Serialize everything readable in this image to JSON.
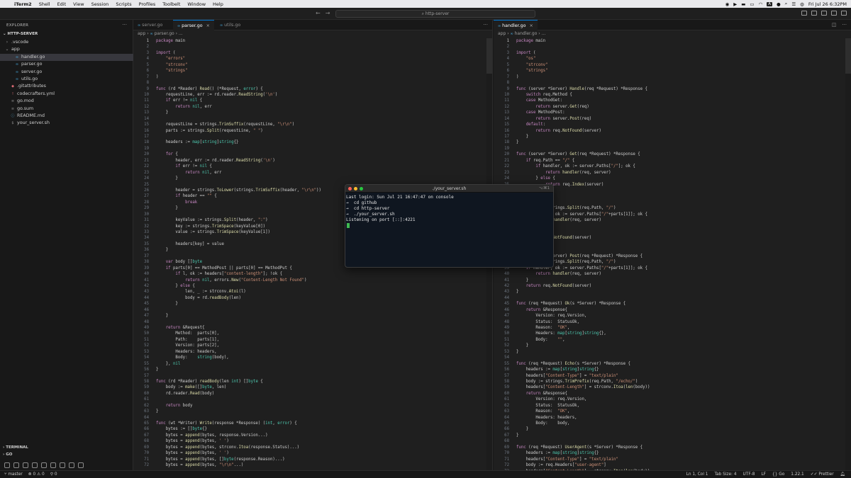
{
  "menubar": {
    "items": [
      "iTerm2",
      "Shell",
      "Edit",
      "View",
      "Session",
      "Scripts",
      "Profiles",
      "Toolbelt",
      "Window",
      "Help"
    ],
    "input_indicator": "A",
    "datetime": "Fri Jul 26  6:32PM"
  },
  "titlebar": {
    "search_text": "http-server"
  },
  "explorer": {
    "title": "EXPLORER",
    "folder": "HTTP-SERVER",
    "tree": [
      {
        "label": ".vscode",
        "indent": 1,
        "chevron": "›",
        "icon": ""
      },
      {
        "label": "app",
        "indent": 1,
        "chevron": "⌄",
        "icon": ""
      },
      {
        "label": "handler.go",
        "indent": 2,
        "chevron": "",
        "icon": "∞",
        "selected": true
      },
      {
        "label": "parser.go",
        "indent": 2,
        "chevron": "",
        "icon": "∞"
      },
      {
        "label": "server.go",
        "indent": 2,
        "chevron": "",
        "icon": "∞"
      },
      {
        "label": "utils.go",
        "indent": 2,
        "chevron": "",
        "icon": "∞"
      },
      {
        "label": ".gitattributes",
        "indent": 1,
        "chevron": "",
        "icon": "◆"
      },
      {
        "label": "codecrafters.yml",
        "indent": 1,
        "chevron": "",
        "icon": "!"
      },
      {
        "label": "go.mod",
        "indent": 1,
        "chevron": "",
        "icon": "≡"
      },
      {
        "label": "go.sum",
        "indent": 1,
        "chevron": "",
        "icon": "≡"
      },
      {
        "label": "README.md",
        "indent": 1,
        "chevron": "",
        "icon": "ⓘ"
      },
      {
        "label": "your_server.sh",
        "indent": 1,
        "chevron": "",
        "icon": "$"
      }
    ],
    "bottom_sections": [
      "TERMINAL",
      "GO"
    ]
  },
  "left_group": {
    "tabs": [
      "server.go",
      "parser.go",
      "utils.go"
    ],
    "active_tab": 1,
    "breadcrumb": [
      "app",
      "parser.go",
      "..."
    ]
  },
  "right_group": {
    "tabs": [
      "handler.go"
    ],
    "breadcrumb": [
      "app",
      "handler.go",
      "..."
    ]
  },
  "statusbar": {
    "branch": "master",
    "problems": "0 ⚠ 0",
    "ports": "0",
    "position": "Ln 1, Col 1",
    "tab_size": "Tab Size: 4",
    "encoding": "UTF-8",
    "eol": "LF",
    "language": "Go",
    "go_version": "1.22.1",
    "prettier": "Prettier"
  },
  "terminal": {
    "title": "./your_server.sh",
    "shortcut": "⌥⌘1",
    "lines": [
      "Last login: Sun Jul 21 16:47:47 on console",
      "→  cd github",
      "→  cd http-server",
      "→  ./your_server.sh",
      "Listening on port [::]:4221"
    ]
  },
  "left_code": [
    "package main",
    "",
    "import (",
    "    \"errors\"",
    "    \"strconv\"",
    "    \"strings\"",
    ")",
    "",
    "func (rd *Reader) Read() (*Request, error) {",
    "    requestLine, err := rd.reader.ReadString('\\n')",
    "    if err != nil {",
    "        return nil, err",
    "    }",
    "",
    "    requestLine = strings.TrimSuffix(requestLine, \"\\r\\n\")",
    "    parts := strings.Split(requestLine, \" \")",
    "",
    "    headers := map[string]string{}",
    "",
    "    for {",
    "        header, err := rd.reader.ReadString('\\n')",
    "        if err != nil {",
    "            return nil, err",
    "        }",
    "",
    "        header = strings.ToLower(strings.TrimSuffix(header, \"\\r\\n\"))",
    "        if header == \"\" {",
    "            break",
    "        }",
    "",
    "        keyValue := strings.Split(header, \":\")",
    "        key := strings.TrimSpace(keyValue[0])",
    "        value := strings.TrimSpace(keyValue[1])",
    "",
    "        headers[key] = value",
    "    }",
    "",
    "    var body []byte",
    "    if parts[0] == MethodPost || parts[0] == MethodPut {",
    "        if l, ok := headers[\"content-length\"]; !ok {",
    "            return nil, errors.New(\"Content-Length Not Found\")",
    "        } else {",
    "            len, _ := strconv.Atoi(l)",
    "            body = rd.readBody(len)",
    "        }",
    "",
    "    }",
    "",
    "    return &Request{",
    "        Method:  parts[0],",
    "        Path:    parts[1],",
    "        Version: parts[2],",
    "        Headers: headers,",
    "        Body:    string(body),",
    "    }, nil",
    "}",
    "",
    "func (rd *Reader) readBody(len int) []byte {",
    "    body := make([]byte, len)",
    "    rd.reader.Read(body)",
    "",
    "    return body",
    "}",
    "",
    "func (wt *Writer) Write(response *Response) (int, error) {",
    "    bytes := []byte{}",
    "    bytes = append(bytes, response.Version...)",
    "    bytes = append(bytes, ' ')",
    "    bytes = append(bytes, strconv.Itoa(response.Status)...)",
    "    bytes = append(bytes, ' ')",
    "    bytes = append(bytes, []byte(response.Reason)...)",
    "    bytes = append(bytes, \"\\r\\n\"...)"
  ],
  "right_code": [
    "package main",
    "",
    "import (",
    "    \"os\"",
    "    \"strconv\"",
    "    \"strings\"",
    ")",
    "",
    "func (server *Server) Handle(req *Request) *Response {",
    "    switch req.Method {",
    "    case MethodGet:",
    "        return server.Get(req)",
    "    case MethodPost:",
    "        return server.Post(req)",
    "    default:",
    "        return req.NotFound(server)",
    "    }",
    "}",
    "",
    "func (server *Server) Get(req *Request) *Response {",
    "    if req.Path == \"/\" {",
    "        if handler, ok := server.Paths[\"/\"]; ok {",
    "            return handler(req, server)",
    "        } else {",
    "            return req.Index(server)",
    "        }",
    "    }",
    "",
    "    parts := strings.Split(req.Path, \"/\")",
    "    if handler, ok := server.Paths[\"/\"+parts[1]]; ok {",
    "        return handler(req, server)",
    "    }",
    "",
    "    return req.NotFound(server)",
    "}",
    "",
    "func (server *Server) Post(req *Request) *Response {",
    "    parts := strings.Split(req.Path, \"/\")",
    "    if handler, ok := server.Paths[\"/\"+parts[1]]; ok {",
    "        return handler(req, server)",
    "    }",
    "    return req.NotFound(server)",
    "}",
    "",
    "func (req *Request) Ok(s *Server) *Response {",
    "    return &Response{",
    "        Version: req.Version,",
    "        Status:  StatusOk,",
    "        Reason:  \"OK\",",
    "        Headers: map[string]string{},",
    "        Body:    \"\",",
    "    }",
    "}",
    "",
    "func (req *Request) Echo(s *Server) *Response {",
    "    headers := map[string]string{}",
    "    headers[\"Content-Type\"] = \"text/plain\"",
    "    body := strings.TrimPrefix(req.Path, \"/echo/\")",
    "    headers[\"Content-Length\"] = strconv.Itoa(len(body))",
    "    return &Response{",
    "        Version: req.Version,",
    "        Status:  StatusOk,",
    "        Reason:  \"OK\",",
    "        Headers: headers,",
    "        Body:    body,",
    "    }",
    "}",
    "",
    "func (req *Request) UserAgent(s *Server) *Response {",
    "    headers := map[string]string{}",
    "    headers[\"Content-Type\"] = \"text/plain\"",
    "    body := req.Headers[\"user-agent\"]",
    "    headers[\"Content-Length\"] = strconv.Itoa(len(body))"
  ]
}
